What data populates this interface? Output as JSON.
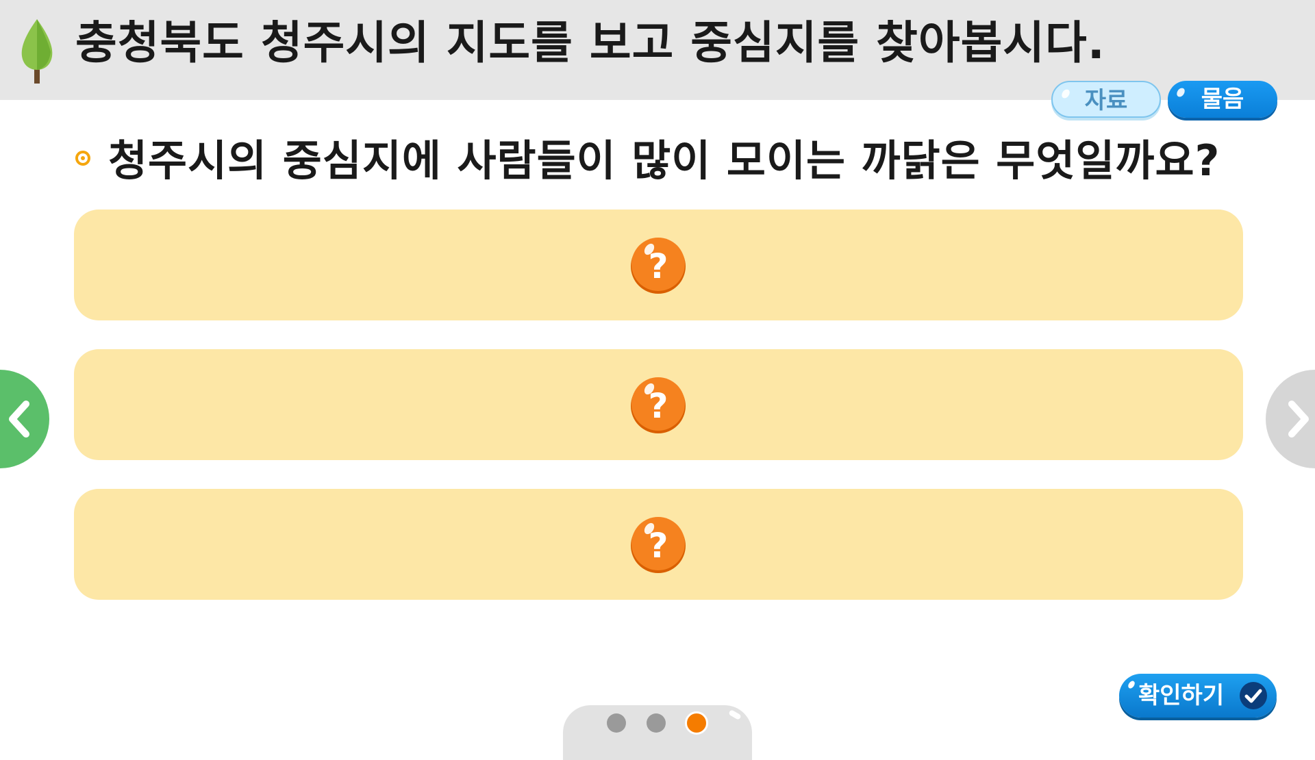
{
  "header": {
    "title": "충청북도 청주시의 지도를 보고 중심지를 찾아봅시다."
  },
  "tabs": {
    "data_label": "자료",
    "question_label": "물음",
    "active": "물음"
  },
  "question": {
    "text": "청주시의 중심지에 사람들이 많이 모이는 까닭은 무엇일까요?"
  },
  "answers": [
    {
      "icon": "question-mark-icon",
      "revealed": false
    },
    {
      "icon": "question-mark-icon",
      "revealed": false
    },
    {
      "icon": "question-mark-icon",
      "revealed": false
    }
  ],
  "pagination": {
    "total": 3,
    "current": 3
  },
  "confirm": {
    "label": "확인하기"
  },
  "colors": {
    "header_bg": "#e6e6e6",
    "answer_bg": "#fde7a6",
    "accent_orange": "#f57c00",
    "nav_prev": "#5bbf6a",
    "nav_next": "#d6d6d6",
    "button_blue": "#0a7fd8"
  }
}
